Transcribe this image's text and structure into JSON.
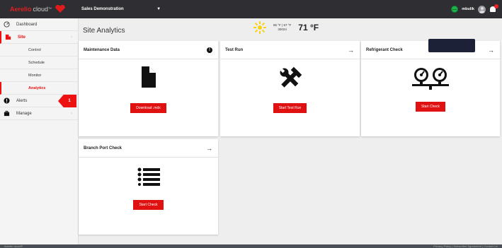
{
  "brand": {
    "name_red": "Aerelio",
    "name_light": "cloud",
    "trademark": "™"
  },
  "header": {
    "site_name": "Sales Demonstration",
    "username": "mbulik"
  },
  "sidebar": {
    "items": [
      {
        "label": "Dashboard",
        "icon": "speedometer-icon"
      },
      {
        "label": "Site",
        "icon": "building-icon"
      },
      {
        "label": "Alerts",
        "icon": "alert-icon",
        "badge": "1"
      },
      {
        "label": "Manage",
        "icon": "briefcase-icon"
      }
    ],
    "site_sub": [
      "Control",
      "Schedule",
      "Monitor",
      "Analytics"
    ]
  },
  "page": {
    "title": "Site Analytics"
  },
  "weather": {
    "high_low": "85 °F | 67 °F",
    "zip": "30024",
    "current": "71 °F"
  },
  "cards": {
    "maintenance": {
      "title": "Maintenance Data",
      "button": "Download .mdx",
      "icon": "document-icon"
    },
    "test_run": {
      "title": "Test Run",
      "button": "Start Test Run",
      "icon": "tools-icon"
    },
    "refrigerant": {
      "title": "Refrigerant Check",
      "button": "Start Check",
      "icon": "gauges-icon"
    },
    "branch_port": {
      "title": "Branch Port Check",
      "button": "Start Check",
      "icon": "list-icon"
    }
  },
  "footer": {
    "left": "Aerelio cloud®",
    "right": "Privacy Policy | Subscriber Agreement | Contact Us"
  },
  "colors": {
    "accent": "#e01111",
    "topbar": "#2e2e33",
    "background": "#eeeeee"
  }
}
